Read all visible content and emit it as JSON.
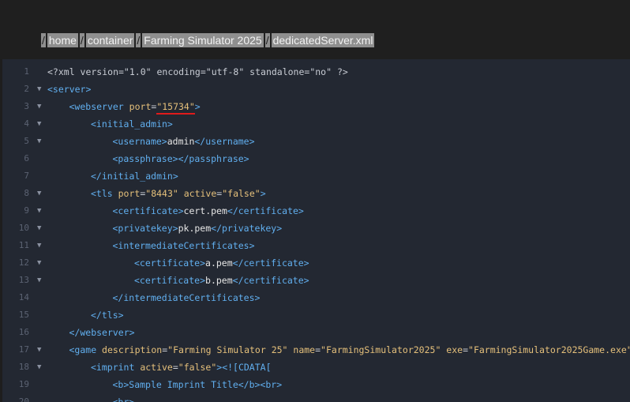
{
  "breadcrumb": {
    "sep": "/",
    "items": [
      "home",
      "container",
      "Farming Simulator 2025",
      "dedicatedServer.xml"
    ]
  },
  "fold_icon": "chevron-down-icon",
  "lines": [
    {
      "n": "1",
      "fold": false,
      "indent": 0,
      "parts": [
        [
          "pi",
          "<?xml version=\"1.0\" encoding=\"utf-8\" standalone=\"no\" ?>"
        ]
      ]
    },
    {
      "n": "2",
      "fold": true,
      "indent": 0,
      "parts": [
        [
          "t",
          "<server>"
        ]
      ]
    },
    {
      "n": "3",
      "fold": true,
      "indent": 1,
      "parts": [
        [
          "t",
          "<webserver "
        ],
        [
          "a",
          "port"
        ],
        [
          "punct",
          "="
        ],
        [
          "v",
          "\"15734\""
        ],
        [
          "t",
          ">"
        ]
      ]
    },
    {
      "n": "4",
      "fold": true,
      "indent": 2,
      "parts": [
        [
          "t",
          "<initial_admin>"
        ]
      ]
    },
    {
      "n": "5",
      "fold": true,
      "indent": 3,
      "parts": [
        [
          "t",
          "<username>"
        ],
        [
          "txt",
          "admin"
        ],
        [
          "t",
          "</username>"
        ]
      ]
    },
    {
      "n": "6",
      "fold": false,
      "indent": 3,
      "parts": [
        [
          "t",
          "<passphrase></passphrase>"
        ]
      ]
    },
    {
      "n": "7",
      "fold": false,
      "indent": 2,
      "parts": [
        [
          "t",
          "</initial_admin>"
        ]
      ]
    },
    {
      "n": "8",
      "fold": true,
      "indent": 2,
      "parts": [
        [
          "t",
          "<tls "
        ],
        [
          "a",
          "port"
        ],
        [
          "punct",
          "="
        ],
        [
          "v",
          "\"8443\""
        ],
        [
          "a",
          " active"
        ],
        [
          "punct",
          "="
        ],
        [
          "v",
          "\"false\""
        ],
        [
          "t",
          ">"
        ]
      ]
    },
    {
      "n": "9",
      "fold": true,
      "indent": 3,
      "parts": [
        [
          "t",
          "<certificate>"
        ],
        [
          "txt",
          "cert.pem"
        ],
        [
          "t",
          "</certificate>"
        ]
      ]
    },
    {
      "n": "10",
      "fold": true,
      "indent": 3,
      "parts": [
        [
          "t",
          "<privatekey>"
        ],
        [
          "txt",
          "pk.pem"
        ],
        [
          "t",
          "</privatekey>"
        ]
      ]
    },
    {
      "n": "11",
      "fold": true,
      "indent": 3,
      "parts": [
        [
          "t",
          "<intermediateCertificates>"
        ]
      ]
    },
    {
      "n": "12",
      "fold": true,
      "indent": 4,
      "parts": [
        [
          "t",
          "<certificate>"
        ],
        [
          "txt",
          "a.pem"
        ],
        [
          "t",
          "</certificate>"
        ]
      ]
    },
    {
      "n": "13",
      "fold": true,
      "indent": 4,
      "parts": [
        [
          "t",
          "<certificate>"
        ],
        [
          "txt",
          "b.pem"
        ],
        [
          "t",
          "</certificate>"
        ]
      ]
    },
    {
      "n": "14",
      "fold": false,
      "indent": 3,
      "parts": [
        [
          "t",
          "</intermediateCertificates>"
        ]
      ]
    },
    {
      "n": "15",
      "fold": false,
      "indent": 2,
      "parts": [
        [
          "t",
          "</tls>"
        ]
      ]
    },
    {
      "n": "16",
      "fold": false,
      "indent": 1,
      "parts": [
        [
          "t",
          "</webserver>"
        ]
      ]
    },
    {
      "n": "17",
      "fold": true,
      "indent": 1,
      "parts": [
        [
          "t",
          "<game "
        ],
        [
          "a",
          "description"
        ],
        [
          "punct",
          "="
        ],
        [
          "v",
          "\"Farming Simulator 25\""
        ],
        [
          "a",
          " name"
        ],
        [
          "punct",
          "="
        ],
        [
          "v",
          "\"FarmingSimulator2025\""
        ],
        [
          "a",
          " exe"
        ],
        [
          "punct",
          "="
        ],
        [
          "v",
          "\"FarmingSimulator2025Game.exe\""
        ],
        [
          "t",
          ">"
        ]
      ]
    },
    {
      "n": "18",
      "fold": true,
      "indent": 2,
      "parts": [
        [
          "t",
          "<imprint "
        ],
        [
          "a",
          "active"
        ],
        [
          "punct",
          "="
        ],
        [
          "v",
          "\"false\""
        ],
        [
          "t",
          "><![CDATA["
        ]
      ]
    },
    {
      "n": "19",
      "fold": false,
      "indent": 3,
      "parts": [
        [
          "t",
          "<b>Sample Imprint Title</b><br>"
        ]
      ]
    },
    {
      "n": "20",
      "fold": false,
      "indent": 3,
      "parts": [
        [
          "t",
          "<br>"
        ]
      ]
    }
  ]
}
